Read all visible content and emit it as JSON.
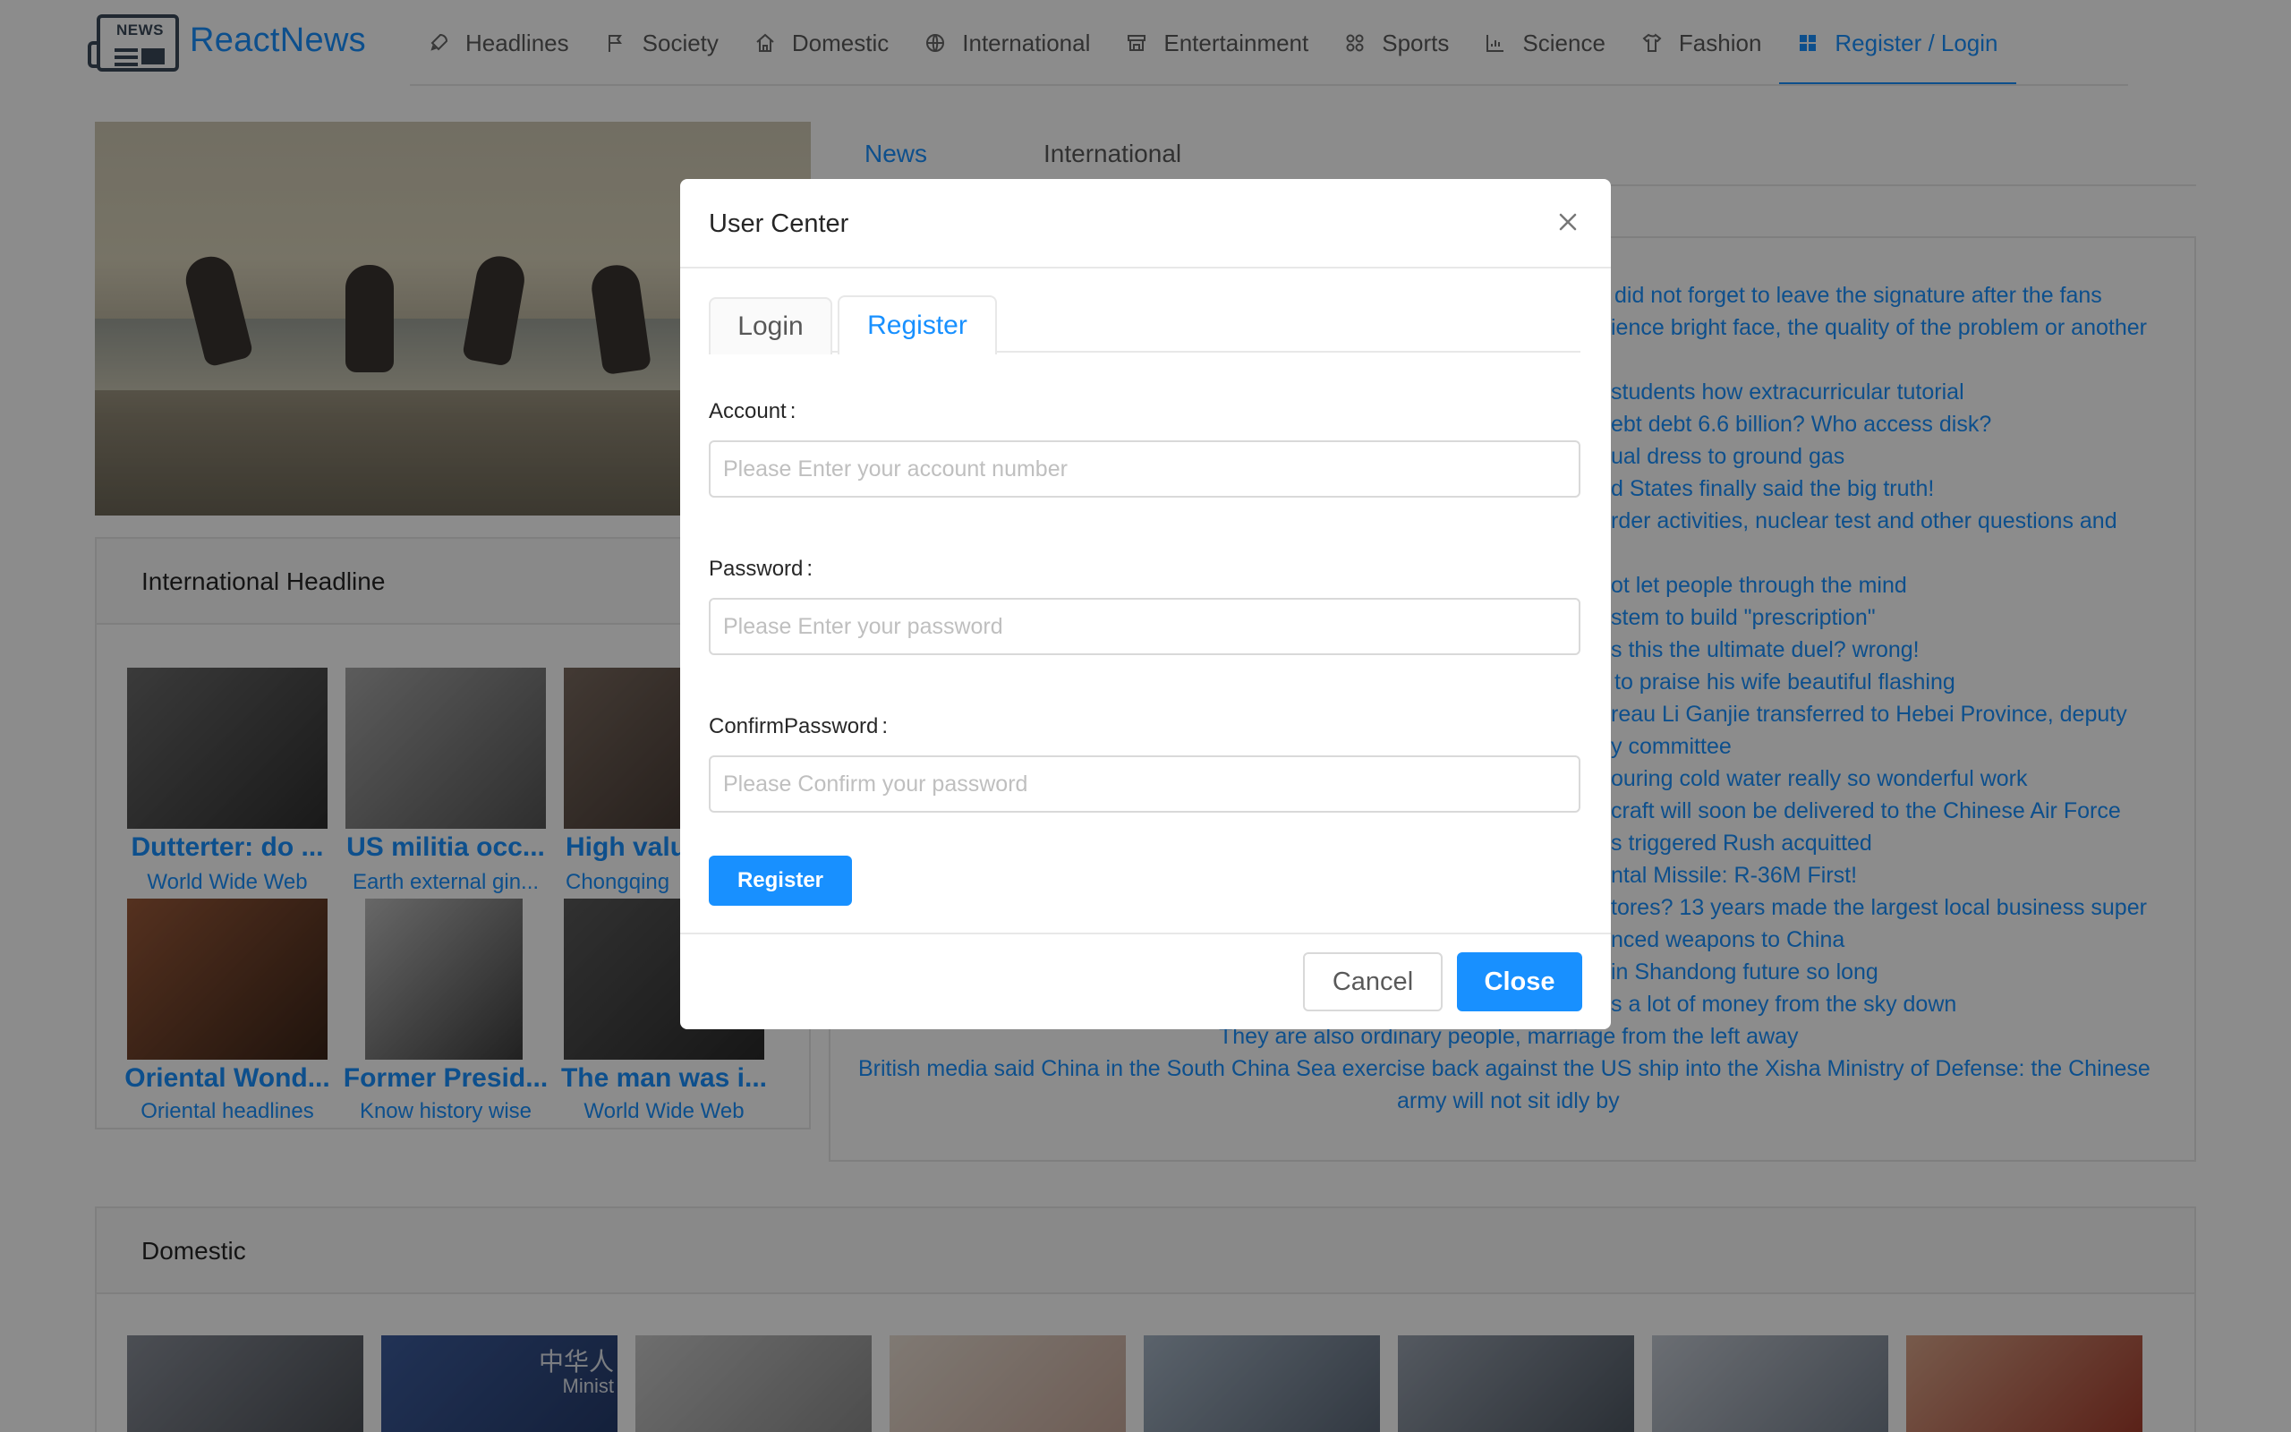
{
  "brand": {
    "name": "ReactNews",
    "logo_text": "NEWS"
  },
  "nav": {
    "items": [
      {
        "label": "Headlines",
        "icon": "rocket-icon"
      },
      {
        "label": "Society",
        "icon": "flag-icon"
      },
      {
        "label": "Domestic",
        "icon": "home-icon"
      },
      {
        "label": "International",
        "icon": "globe-icon"
      },
      {
        "label": "Entertainment",
        "icon": "shop-icon"
      },
      {
        "label": "Sports",
        "icon": "appstore-icon"
      },
      {
        "label": "Science",
        "icon": "chart-icon"
      },
      {
        "label": "Fashion",
        "icon": "shirt-icon"
      },
      {
        "label": "Register / Login",
        "icon": "grid-icon",
        "active": true
      }
    ]
  },
  "international_headline": {
    "title": "International Headline",
    "items": [
      {
        "caption": "Dutterter: do ...",
        "source": "World Wide Web"
      },
      {
        "caption": "US militia occ...",
        "source": "Earth external gin..."
      },
      {
        "caption": "High valu",
        "source": "Chongqing"
      },
      {
        "caption": "Oriental Wond...",
        "source": "Oriental headlines"
      },
      {
        "caption": "Former Presid...",
        "source": "Know history wise"
      },
      {
        "caption": "The man was i...",
        "source": "World Wide Web"
      }
    ]
  },
  "news_tabs": {
    "news": "News",
    "international": "International"
  },
  "news_list": [
    "did not forget to leave the signature after the fans",
    "ience bright face, the quality of the problem or another",
    "students how extracurricular tutorial",
    "ebt debt 6.6 billion? Who access disk?",
    "ual dress to ground gas",
    "d States finally said the big truth!",
    "rder activities, nuclear test and other questions and",
    "ot let people through the mind",
    "stem to build \"prescription\"",
    "s this the ultimate duel? wrong!",
    "to praise his wife beautiful flashing",
    "reau Li Ganjie transferred to Hebei Province, deputy",
    "y committee",
    "ouring cold water really so wonderful work",
    "craft will soon be delivered to the Chinese Air Force",
    "s triggered Rush acquitted",
    "ntal Missile: R-36M First!",
    "tores? 13 years made the largest local business super",
    "nced weapons to China",
    "in Shandong future so long",
    "s a lot of money from the sky down",
    "They are also ordinary people, marriage from the left away",
    "British media said China in the South China Sea exercise back against the US ship into the Xisha Ministry of Defense: the Chinese",
    "army will not sit idly by"
  ],
  "domestic": {
    "title": "Domestic",
    "thumb_text_1": "中华人",
    "thumb_text_2": "Minist"
  },
  "modal": {
    "title": "User Center",
    "tabs": {
      "login": "Login",
      "register": "Register"
    },
    "account": {
      "label": "Account",
      "placeholder": "Please Enter your account number"
    },
    "password": {
      "label": "Password",
      "placeholder": "Please Enter your password"
    },
    "confirm": {
      "label": "ConfirmPassword",
      "placeholder": "Please Confirm your password"
    },
    "colon": ":",
    "register_button": "Register",
    "cancel_button": "Cancel",
    "close_button": "Close"
  },
  "colors": {
    "primary": "#1890ff",
    "mask": "rgba(0,0,0,0.45)"
  }
}
